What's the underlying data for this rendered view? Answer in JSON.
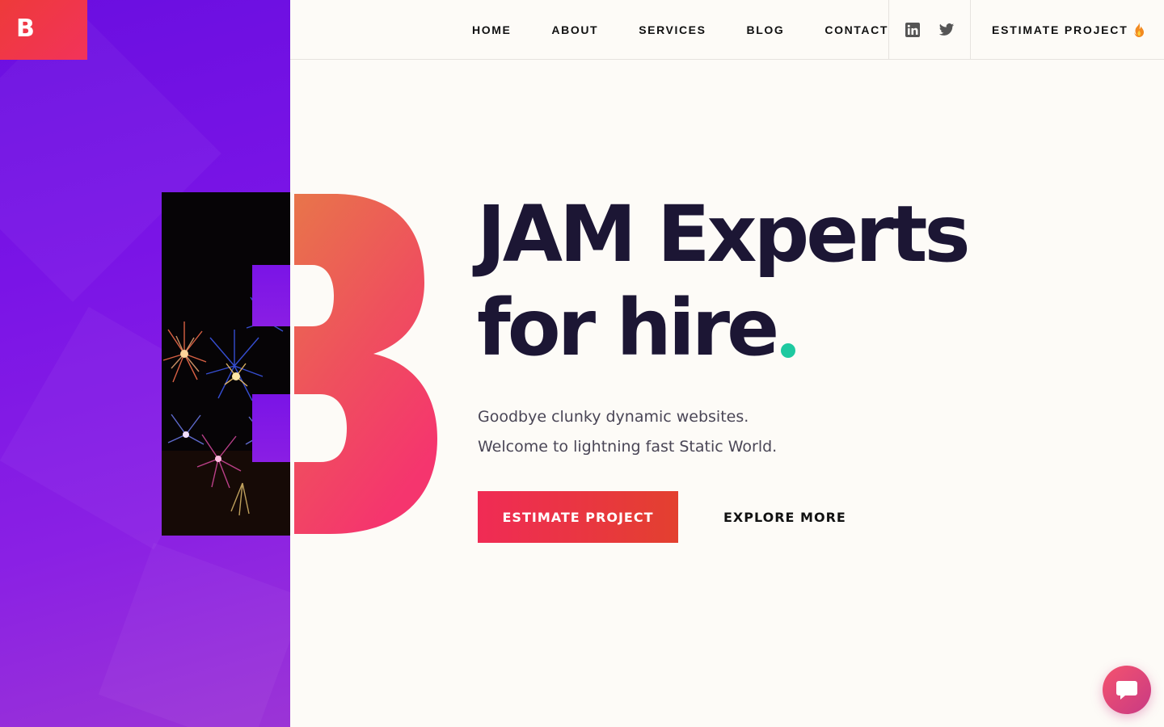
{
  "brand": {
    "logo_letter": "B"
  },
  "nav": {
    "items": [
      {
        "label": "HOME"
      },
      {
        "label": "ABOUT"
      },
      {
        "label": "SERVICES"
      },
      {
        "label": "BLOG"
      },
      {
        "label": "CONTACT"
      }
    ],
    "social": [
      {
        "icon": "linkedin-icon"
      },
      {
        "icon": "twitter-icon"
      }
    ],
    "cta_label": "ESTIMATE PROJECT",
    "cta_icon": "fire-icon"
  },
  "hero": {
    "title_line1": "JAM Experts",
    "title_line2": "for hire",
    "accent_color": "#1ec9a0",
    "subtitle_line1": "Goodbye clunky dynamic websites.",
    "subtitle_line2": "Welcome to lightning fast Static World.",
    "primary_button": "ESTIMATE PROJECT",
    "secondary_button": "EXPLORE MORE"
  },
  "colors": {
    "panel_purple": "#7a14e6",
    "brand_red": "#f02b55",
    "text_dark": "#1c1634"
  },
  "chat": {
    "icon": "chat-bubble-icon"
  }
}
